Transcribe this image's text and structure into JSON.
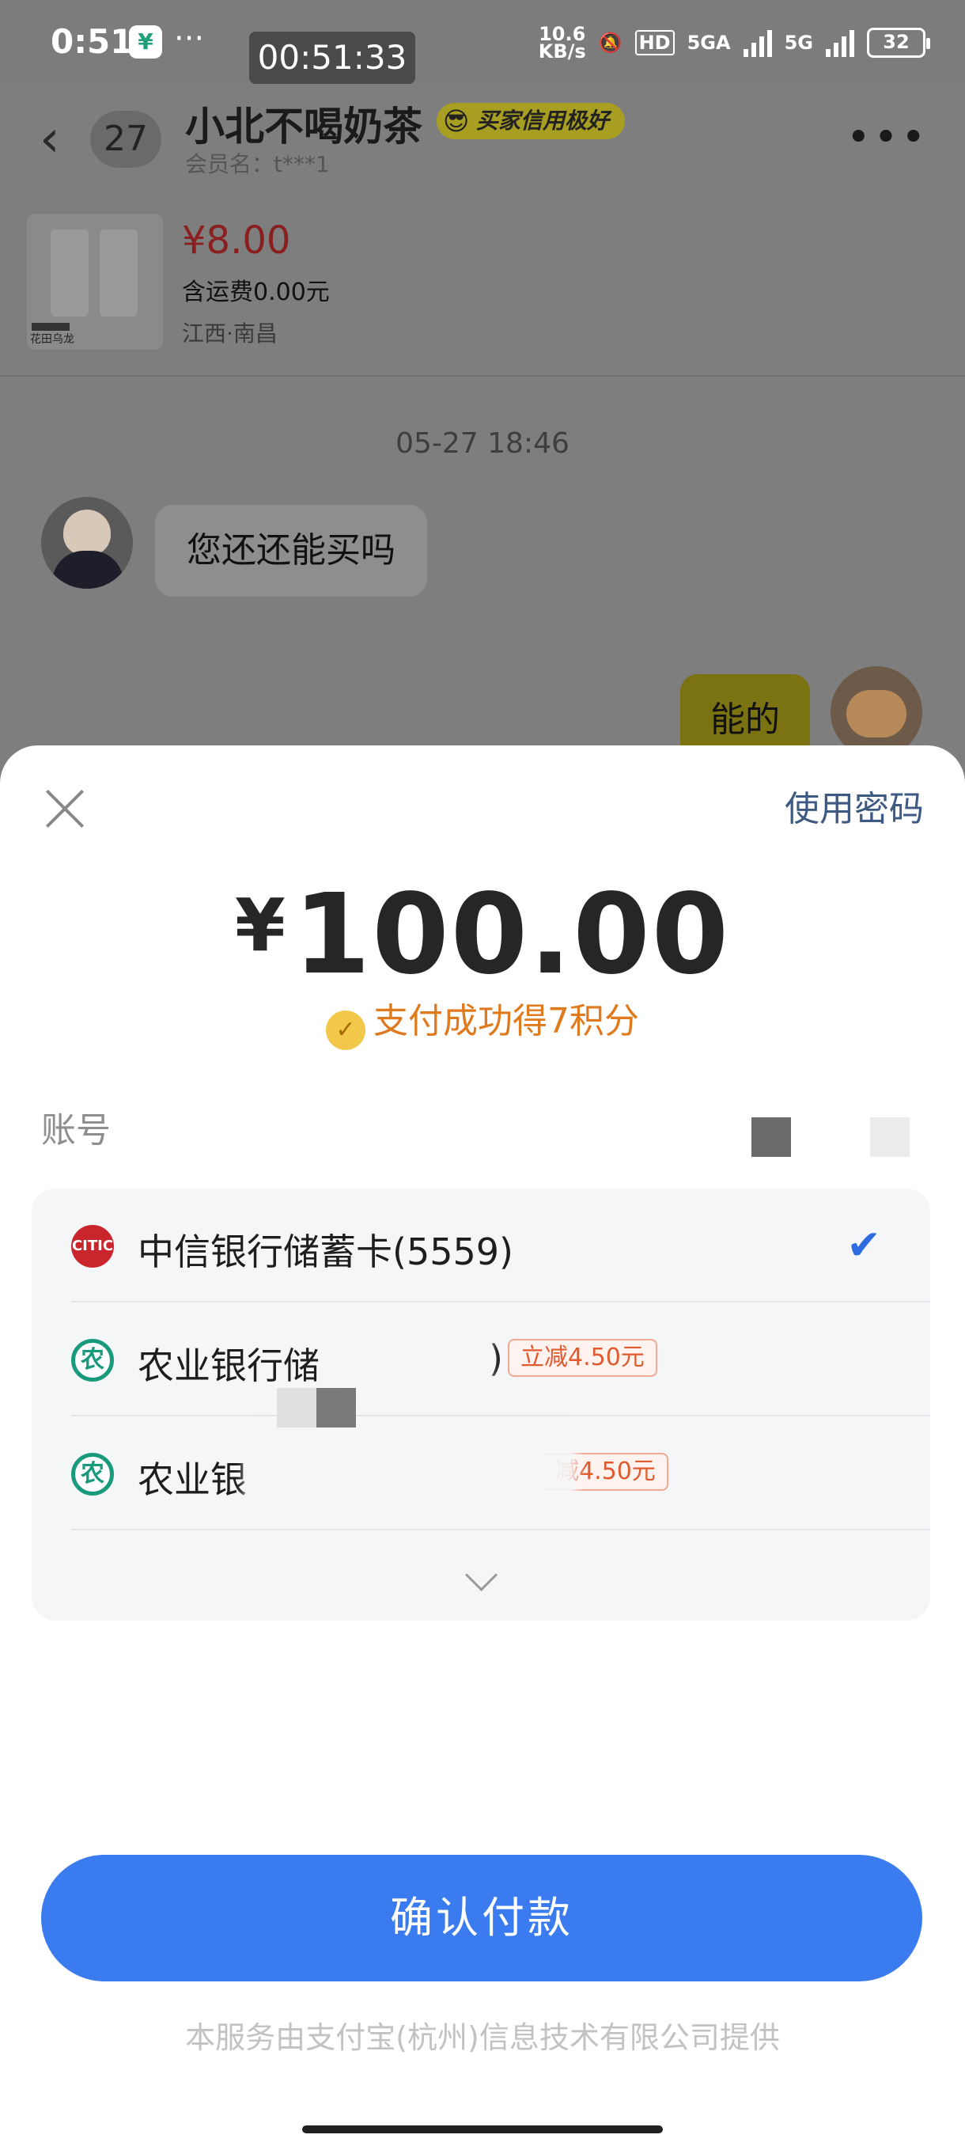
{
  "status_bar": {
    "time": "0:51",
    "app_icon": "bank-app-icon",
    "more": "···",
    "recording_timer": "00:51:33",
    "network_speed": "10.6",
    "network_unit": "KB/s",
    "hd": "HD",
    "net1": "5GA",
    "net2": "5G",
    "battery": "32"
  },
  "chat_header": {
    "unread_count": "27",
    "seller_name": "小北不喝奶茶",
    "credit_badge": "买家信用极好",
    "member_label": "会员名：t***1"
  },
  "product": {
    "price": "¥8.00",
    "shipping": "含运费0.00元",
    "location": "江西·南昌",
    "thumb_tag": "花田乌龙"
  },
  "chat": {
    "timestamp": "05-27 18:46",
    "message_left": "您还还能买吗",
    "message_right": "能的"
  },
  "payment": {
    "use_password": "使用密码",
    "currency": "¥",
    "amount": "100.00",
    "points_icon": "coin-icon",
    "points_text": "支付成功得7积分",
    "account_label": "账号",
    "cards": [
      {
        "bank_icon": "citic-bank-icon",
        "icon_text": "CITIC",
        "name": "中信银行储蓄卡(5559)",
        "selected": true
      },
      {
        "bank_icon": "abc-bank-icon",
        "icon_text": "农",
        "name": "农业银行储",
        "name_tail": ")",
        "discount": "立减4.50元"
      },
      {
        "bank_icon": "abc-bank-icon",
        "icon_text": "农",
        "name": "农业银",
        "discount": "减4.50元"
      }
    ],
    "confirm_button": "确认付款",
    "footer": "本服务由支付宝(杭州)信息技术有限公司提供"
  },
  "colors": {
    "primary_button": "#3a7bef",
    "points_orange": "#e07a1e",
    "check_blue": "#2d6be0",
    "discount_red": "#e05a2e"
  }
}
